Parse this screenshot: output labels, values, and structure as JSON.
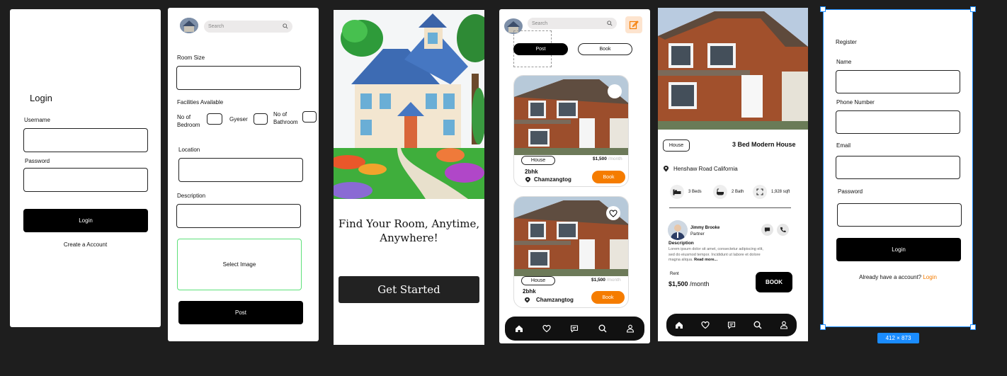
{
  "login": {
    "title": "Login",
    "username_label": "Username",
    "password_label": "Password",
    "login_button": "Login",
    "create_account": "Create a Account"
  },
  "post": {
    "search_placeholder": "Search",
    "room_size_label": "Room Size",
    "facilities_label": "Facilities Available",
    "bedroom_label_1": "No of",
    "bedroom_label_2": "Bedroom",
    "geyser_label": "Gyeser",
    "bathroom_label_1": "No of",
    "bathroom_label_2": "Bathroom",
    "location_label": "Location",
    "description_label": "Description",
    "select_image": "Select Image",
    "post_button": "Post"
  },
  "welcome": {
    "headline_1": "Find Your Room, Anytime,",
    "headline_2": "Anywhere!",
    "cta": "Get Started"
  },
  "feed": {
    "search_placeholder": "Search",
    "tab_post": "Post",
    "tab_book": "Book",
    "cards": [
      {
        "tag": "House",
        "price": "$1,500",
        "per": "/month",
        "type": "2bhk",
        "location": "Chamzangtog",
        "book": "Book"
      },
      {
        "tag": "House",
        "price": "$1,500",
        "per": "/month",
        "type": "2bhk",
        "location": "Chamzangtog",
        "book": "Book"
      }
    ]
  },
  "detail": {
    "tag": "House",
    "title": "3 Bed Modern House",
    "address": "Henshaw Road California",
    "beds": "3 Beds",
    "baths": "2 Bath",
    "area": "1,928 sqft",
    "agent_name": "Jimmy Brooke",
    "agent_role": "Partner",
    "desc_heading": "Description",
    "desc_text_1": "Lorem ipsum dolor sit amet, consectetur adipiscing elit,",
    "desc_text_2": "sed do eiusmod tempor. Incididunt ut labore et dolore",
    "desc_text_3": "magna aliqua.",
    "read_more": "Read more...",
    "rent_label": "Rent",
    "rent_price": "$1,500",
    "rent_per": "/month",
    "book_button": "BOOK"
  },
  "register": {
    "title": "Register",
    "name_label": "Name",
    "phone_label": "Phone Number",
    "email_label": "Email",
    "password_label": "Password",
    "login_button": "Login",
    "already": "Already have a account?",
    "login_link": "Login",
    "size_badge": "412 × 873"
  },
  "colors": {
    "accent": "#f57c00",
    "selection": "#1a8cff",
    "background": "#1e1e1e",
    "green_border": "#5ee07a"
  }
}
